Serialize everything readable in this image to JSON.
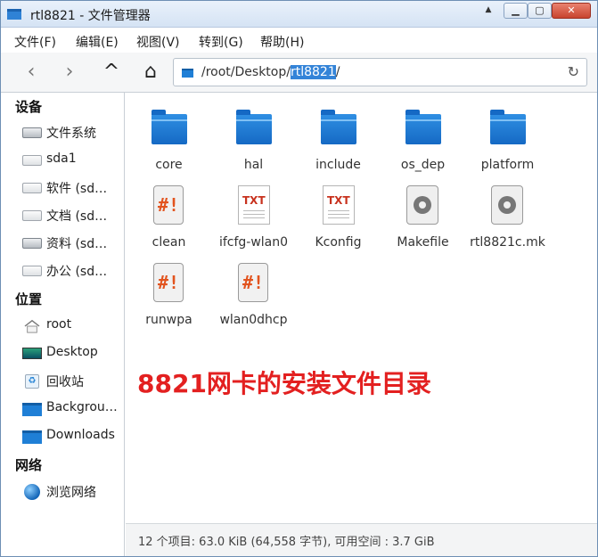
{
  "window": {
    "title": "rtl8821 - 文件管理器"
  },
  "titlebar_buttons": {
    "dropdown": "▲",
    "minimize": "▁",
    "maximize": "▢",
    "close": "✕"
  },
  "menu": [
    "文件(F)",
    "编辑(E)",
    "视图(V)",
    "转到(G)",
    "帮助(H)"
  ],
  "toolbar": {
    "back": "‹",
    "forward": "›",
    "up": "^",
    "home": "⌂",
    "refresh": "↻"
  },
  "address": {
    "prefix": "/root/Desktop/",
    "selected": "rtl8821",
    "suffix": "/"
  },
  "sidebar": {
    "devices_title": "设备",
    "devices": [
      "文件系统",
      "sda1",
      "软件 (sd…",
      "文档 (sd…",
      "资料 (sd…",
      "办公 (sd…"
    ],
    "places_title": "位置",
    "places": [
      "root",
      "Desktop",
      "回收站",
      "Backgrou…",
      "Downloads"
    ],
    "network_title": "网络",
    "network": [
      "浏览网络"
    ]
  },
  "files": [
    {
      "name": "core",
      "icon": "folder-icon"
    },
    {
      "name": "hal",
      "icon": "folder-icon"
    },
    {
      "name": "include",
      "icon": "folder-icon"
    },
    {
      "name": "os_dep",
      "icon": "folder-icon"
    },
    {
      "name": "platform",
      "icon": "folder-icon"
    },
    {
      "name": "clean",
      "icon": "script-icon"
    },
    {
      "name": "ifcfg-wlan0",
      "icon": "text-file-icon"
    },
    {
      "name": "Kconfig",
      "icon": "text-file-icon"
    },
    {
      "name": "Makefile",
      "icon": "makefile-icon"
    },
    {
      "name": "rtl8821c.mk",
      "icon": "makefile-icon"
    },
    {
      "name": "runwpa",
      "icon": "script-icon"
    },
    {
      "name": "wlan0dhcp",
      "icon": "script-icon"
    }
  ],
  "icon_glyphs": {
    "script": "#!",
    "text": "TXT",
    "trash": "♻"
  },
  "annotation": "8821网卡的安装文件目录",
  "status": "12 个项目: 63.0 KiB (64,558 字节), 可用空间 : 3.7 GiB",
  "colors": {
    "annotation": "#e32020",
    "folder": "#1f7fd6",
    "selection": "#3484d8"
  }
}
